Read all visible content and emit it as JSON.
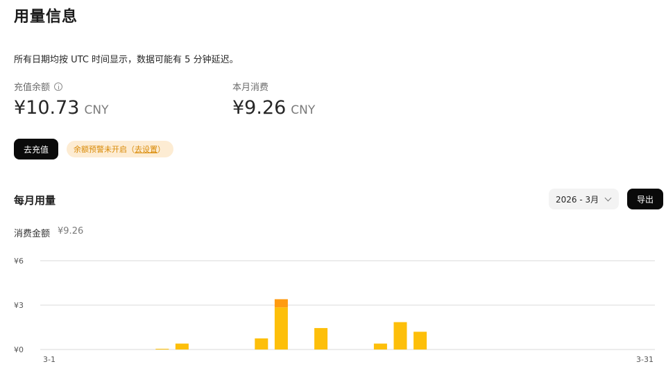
{
  "page": {
    "title": "用量信息",
    "notice": "所有日期均按 UTC 时间显示，数据可能有 5 分钟延迟。"
  },
  "balance": {
    "label": "充值余额",
    "amount": "¥10.73",
    "currency": "CNY"
  },
  "monthly_spend": {
    "label": "本月消费",
    "amount": "¥9.26",
    "currency": "CNY"
  },
  "actions": {
    "recharge_label": "去充值",
    "export_label": "导出"
  },
  "alert": {
    "text": "余额预警未开启（",
    "link": "去设置",
    "suffix": "）"
  },
  "usage": {
    "section_title": "每月用量",
    "month_selected": "2026 - 3月",
    "total_label": "消费金额",
    "total_value": "¥9.26"
  },
  "colors": {
    "bar_primary": "#fdbf0a",
    "bar_secondary": "#ff9b10",
    "grid": "#d9d9d9"
  },
  "chart_data": {
    "type": "bar",
    "x_start_label": "3-1",
    "x_end_label": "3-31",
    "y_ticks": [
      "¥6",
      "¥3",
      "¥0"
    ],
    "ylim": [
      0,
      6
    ],
    "categories": [
      "3-1",
      "3-2",
      "3-3",
      "3-4",
      "3-5",
      "3-6",
      "3-7",
      "3-8",
      "3-9",
      "3-10",
      "3-11",
      "3-12",
      "3-13",
      "3-14",
      "3-15",
      "3-16",
      "3-17",
      "3-18",
      "3-19",
      "3-20",
      "3-21",
      "3-22",
      "3-23",
      "3-24",
      "3-25",
      "3-26",
      "3-27",
      "3-28",
      "3-29",
      "3-30",
      "3-31"
    ],
    "series": [
      {
        "values": [
          0,
          0,
          0,
          0.05,
          0.4,
          0,
          0,
          0,
          0.75,
          2.85,
          0,
          1.45,
          0,
          0,
          0.4,
          1.85,
          1.2,
          0,
          0,
          0,
          0,
          0,
          0,
          0,
          0,
          0,
          0,
          0,
          0,
          0,
          0
        ]
      },
      {
        "values": [
          0,
          0,
          0,
          0,
          0,
          0,
          0,
          0,
          0,
          0.55,
          0,
          0,
          0,
          0,
          0,
          0,
          0,
          0,
          0,
          0,
          0,
          0,
          0,
          0,
          0,
          0,
          0,
          0,
          0,
          0,
          0
        ]
      }
    ]
  }
}
